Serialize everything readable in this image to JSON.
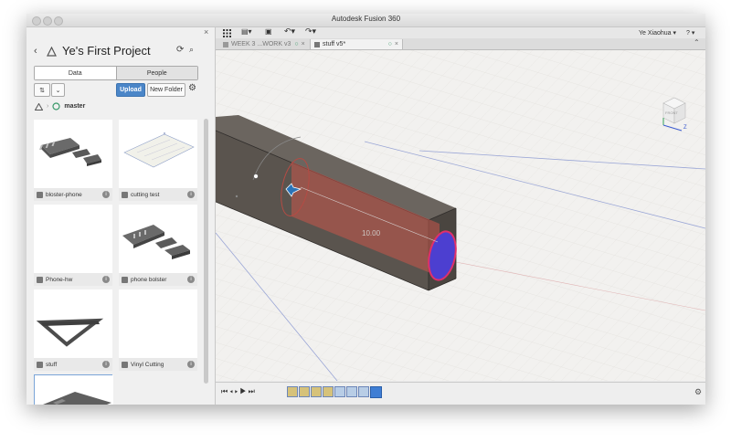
{
  "window": {
    "title": "Autodesk Fusion 360"
  },
  "panel": {
    "project_title": "Ye's First Project",
    "tabs": [
      "Data",
      "People"
    ],
    "upload_label": "Upload",
    "new_folder_label": "New Folder",
    "branch_label": "master",
    "items": [
      {
        "name": "bloster-phone",
        "info": "i"
      },
      {
        "name": "cutting test",
        "info": "i"
      },
      {
        "name": "Phone-hw",
        "info": "i"
      },
      {
        "name": "phone bolster",
        "info": "i"
      },
      {
        "name": "stuff",
        "info": "i"
      },
      {
        "name": "Vinyl Cutting",
        "info": "i"
      }
    ]
  },
  "toolbar": {
    "user_label": "Ye Xiaohua ▾",
    "help_label": "? ▾"
  },
  "tabs": [
    {
      "label": "WEEK 3 ...WORK v3"
    },
    {
      "label": "stuff v5*"
    }
  ],
  "viewport": {
    "dimension_label": "10.00",
    "viewcube_label": "FRONT",
    "axis_z": "Z"
  }
}
